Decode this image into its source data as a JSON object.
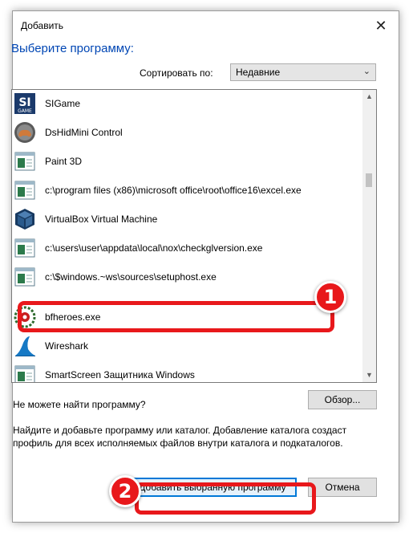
{
  "dialog": {
    "title": "Добавить",
    "heading": "Выберите программу:",
    "sort_label": "Сортировать по:",
    "sort_value": "Недавние"
  },
  "programs": [
    {
      "label": "SIGame",
      "icon": "sigame-icon"
    },
    {
      "label": "DsHidMini Control",
      "icon": "dshidmini-icon"
    },
    {
      "label": "Paint 3D",
      "icon": "generic-app-icon"
    },
    {
      "label": "c:\\program files (x86)\\microsoft office\\root\\office16\\excel.exe",
      "icon": "generic-app-icon"
    },
    {
      "label": "VirtualBox Virtual Machine",
      "icon": "virtualbox-icon"
    },
    {
      "label": "c:\\users\\user\\appdata\\local\\nox\\checkglversion.exe",
      "icon": "generic-app-icon"
    },
    {
      "label": "c:\\$windows.~ws\\sources\\setuphost.exe",
      "icon": "generic-app-icon"
    },
    {
      "label": "bfheroes.exe",
      "icon": "bfheroes-icon",
      "highlighted": true
    },
    {
      "label": "Wireshark",
      "icon": "wireshark-icon"
    },
    {
      "label": "SmartScreen Защитника Windows",
      "icon": "generic-app-icon"
    }
  ],
  "footer": {
    "cant_find": "Не можете найти программу?",
    "browse": "Обзор...",
    "description": "Найдите и добавьте программу или каталог. Добавление каталога создаст профиль для всех исполняемых файлов внутри каталога и подкаталогов.",
    "add_button": "Добавить выбранную программу",
    "cancel_button": "Отмена"
  },
  "annotations": {
    "step1": "1",
    "step2": "2"
  },
  "icon_text": {
    "sigame_top": "SI",
    "sigame_bottom": "GAME"
  },
  "colors": {
    "heading": "#0046b4",
    "annotation_red": "#e8181b",
    "focus_blue": "#0078d7"
  }
}
